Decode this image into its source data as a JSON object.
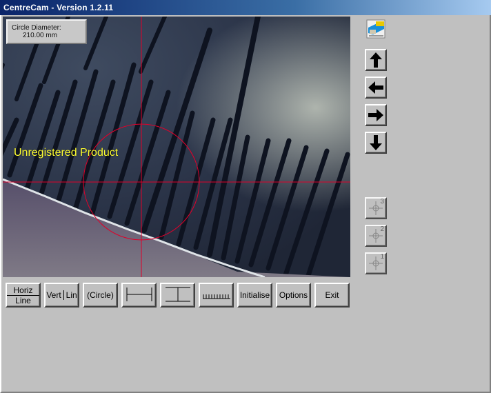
{
  "window": {
    "title": "CentreCam - Version 1.2.11"
  },
  "readout": {
    "label": "Circle Diameter:",
    "value": "210.00  mm"
  },
  "overlay": {
    "watermark": "Unregistered Product",
    "crosshair_color": "#e0002a"
  },
  "toolbar": {
    "horiz_line": {
      "line1": "Horiz",
      "line2": "Line"
    },
    "vert_line": {
      "left": "Vert",
      "right": "Lin"
    },
    "circle": "(Circle)",
    "h_measure_icon": "horizontal-measure-icon",
    "v_measure_icon": "vertical-measure-icon",
    "ruler_icon": "ruler-icon",
    "initialise": "Initialise",
    "options": "Options",
    "exit": "Exit"
  },
  "side": {
    "camera_icon": "camera-icon",
    "up_icon": "arrow-up-icon",
    "left_icon": "arrow-left-icon",
    "right_icon": "arrow-right-icon",
    "down_icon": "arrow-down-icon",
    "preset3": "3",
    "preset2": "2",
    "preset1": "1"
  }
}
